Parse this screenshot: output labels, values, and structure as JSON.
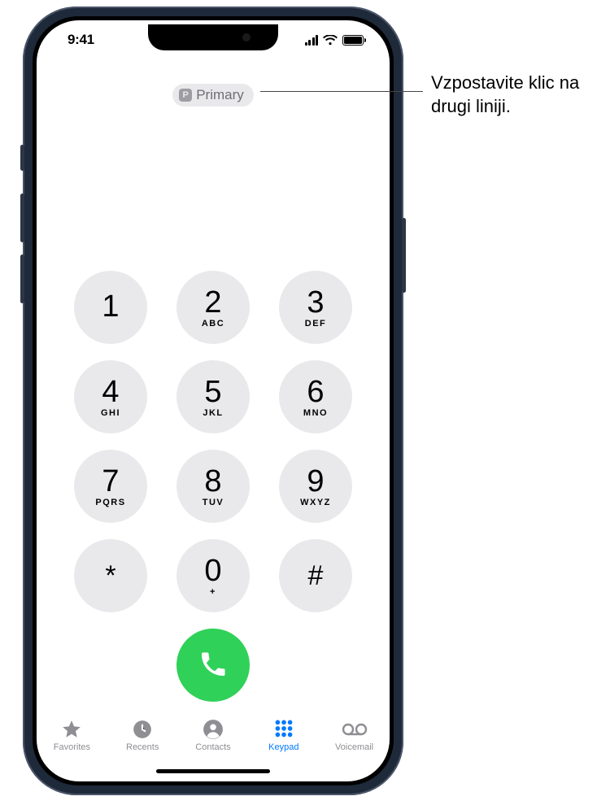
{
  "status_bar": {
    "time": "9:41"
  },
  "line_selector": {
    "badge_letter": "P",
    "label": "Primary"
  },
  "keypad": {
    "keys": [
      {
        "digit": "1",
        "letters": ""
      },
      {
        "digit": "2",
        "letters": "ABC"
      },
      {
        "digit": "3",
        "letters": "DEF"
      },
      {
        "digit": "4",
        "letters": "GHI"
      },
      {
        "digit": "5",
        "letters": "JKL"
      },
      {
        "digit": "6",
        "letters": "MNO"
      },
      {
        "digit": "7",
        "letters": "PQRS"
      },
      {
        "digit": "8",
        "letters": "TUV"
      },
      {
        "digit": "9",
        "letters": "WXYZ"
      },
      {
        "digit": "*",
        "letters": ""
      },
      {
        "digit": "0",
        "letters": "+"
      },
      {
        "digit": "#",
        "letters": ""
      }
    ]
  },
  "tabs": {
    "items": [
      {
        "label": "Favorites",
        "active": false
      },
      {
        "label": "Recents",
        "active": false
      },
      {
        "label": "Contacts",
        "active": false
      },
      {
        "label": "Keypad",
        "active": true
      },
      {
        "label": "Voicemail",
        "active": false
      }
    ]
  },
  "callout": {
    "text": "Vzpostavite klic na drugi liniji."
  },
  "colors": {
    "accent": "#007aff",
    "call_green": "#30d158",
    "key_bg": "#e9e9eb"
  }
}
